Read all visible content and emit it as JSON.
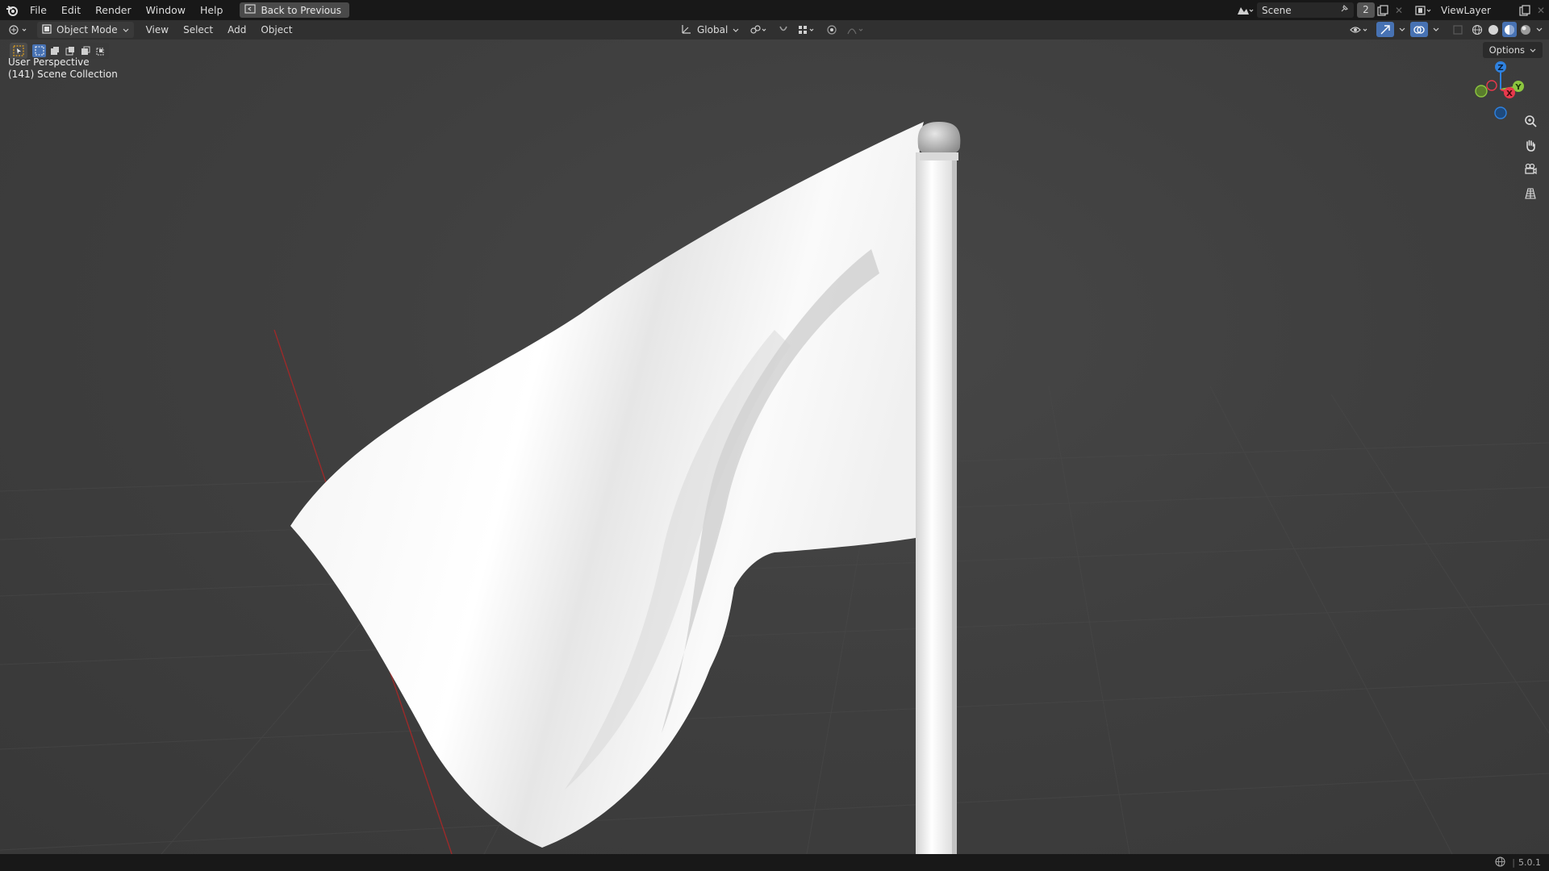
{
  "topbar": {
    "menus": [
      "File",
      "Edit",
      "Render",
      "Window",
      "Help"
    ],
    "back_button": "Back to Previous",
    "scene_name": "Scene",
    "scene_users": "2",
    "view_layer": "ViewLayer"
  },
  "header": {
    "mode": "Object Mode",
    "menus": [
      "View",
      "Select",
      "Add",
      "Object"
    ],
    "transform_orientation": "Global"
  },
  "viewport": {
    "perspective_label": "User Perspective",
    "collection_label": "(141) Scene Collection",
    "options_label": "Options",
    "gizmo": {
      "z": "Z",
      "x": "X",
      "y": "Y"
    }
  },
  "statusbar": {
    "version": "5.0.1"
  },
  "colors": {
    "gizmo_x": "#e8394c",
    "gizmo_y": "#8cc63f",
    "gizmo_z": "#2f82e0",
    "x_axis_line": "#9b2a2a",
    "accent": "#4772b3"
  },
  "icons": [
    "blender-logo-icon",
    "back-icon",
    "scene-icon",
    "pin-icon",
    "duplicate-icon",
    "view-layer-icon",
    "editor-type-icon",
    "object-mode-icon",
    "orientation-icon",
    "snap-icon",
    "proportional-icon",
    "zoom-icon",
    "pan-icon",
    "camera-icon",
    "grid-icon",
    "globe-icon"
  ]
}
